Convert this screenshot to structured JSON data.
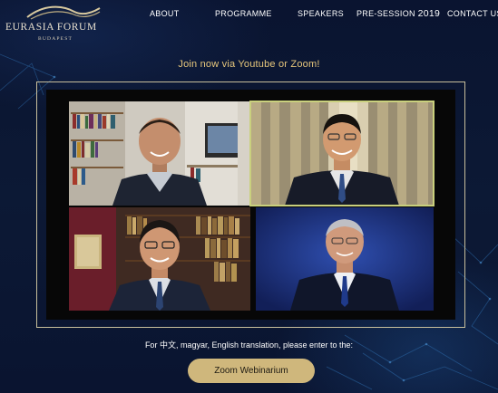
{
  "brand": {
    "title": "EURASIA FORUM",
    "subtitle": "BUDAPEST",
    "logo_icon": "wave-swoosh-icon"
  },
  "nav": {
    "about": "ABOUT",
    "programme": "PROGRAMME",
    "speakers": "SPEAKERS",
    "presession_label": "PRE-SESSION",
    "presession_year": "2019",
    "contact": "CONTACT US"
  },
  "main": {
    "join_text": "Join now via Youtube or Zoom!",
    "instructions": "For 中文, magyar, English translation, please enter to the:",
    "zoom_button": "Zoom Webinarium"
  },
  "video": {
    "participants": [
      {
        "position": "top-left",
        "scene": "bookshelf office",
        "active": false
      },
      {
        "position": "top-right",
        "scene": "curtained room",
        "active": true
      },
      {
        "position": "bottom-left",
        "scene": "library",
        "active": false
      },
      {
        "position": "bottom-right",
        "scene": "blue backdrop",
        "active": false
      }
    ]
  },
  "colors": {
    "background": "#0b1630",
    "accent_gold": "#e7c77c",
    "button_gold": "#cfb77c",
    "active_speaker_border": "#c9d07d"
  }
}
